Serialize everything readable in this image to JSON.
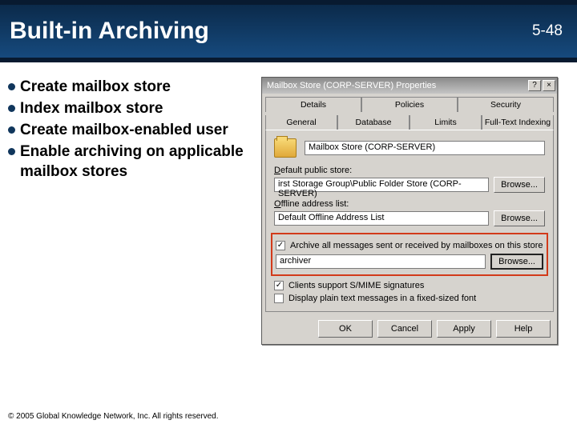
{
  "header": {
    "title": "Built-in Archiving",
    "slide_number": "5-48"
  },
  "bullets": [
    "Create mailbox store",
    "Index mailbox store",
    "Create mailbox-enabled user",
    "Enable archiving on applicable mailbox stores"
  ],
  "dialog": {
    "title": "Mailbox Store (CORP-SERVER) Properties",
    "help_btn": "?",
    "close_btn": "×",
    "tabs_row1": [
      "Details",
      "Policies",
      "Security"
    ],
    "tabs_row2": [
      "General",
      "Database",
      "Limits",
      "Full-Text Indexing"
    ],
    "active_tab": "General",
    "name_value": "Mailbox Store (CORP-SERVER)",
    "default_public_store": {
      "label": "Default public store:",
      "value": "irst Storage Group\\Public Folder Store (CORP-SERVER)",
      "browse": "Browse..."
    },
    "offline_address_list": {
      "label": "Offline address list:",
      "value": "Default Offline Address List",
      "browse": "Browse..."
    },
    "archive_checkbox": {
      "checked": true,
      "label": "Archive all messages sent or received by mailboxes on this store"
    },
    "archive_value": "archiver",
    "archive_browse": "Browse...",
    "smime_checkbox": {
      "checked": true,
      "label": "Clients support S/MIME signatures"
    },
    "plaintext_checkbox": {
      "checked": false,
      "label": "Display plain text messages in a fixed-sized font"
    },
    "buttons": {
      "ok": "OK",
      "cancel": "Cancel",
      "apply": "Apply",
      "help": "Help"
    }
  },
  "footer": "© 2005 Global Knowledge Network, Inc. All rights reserved."
}
